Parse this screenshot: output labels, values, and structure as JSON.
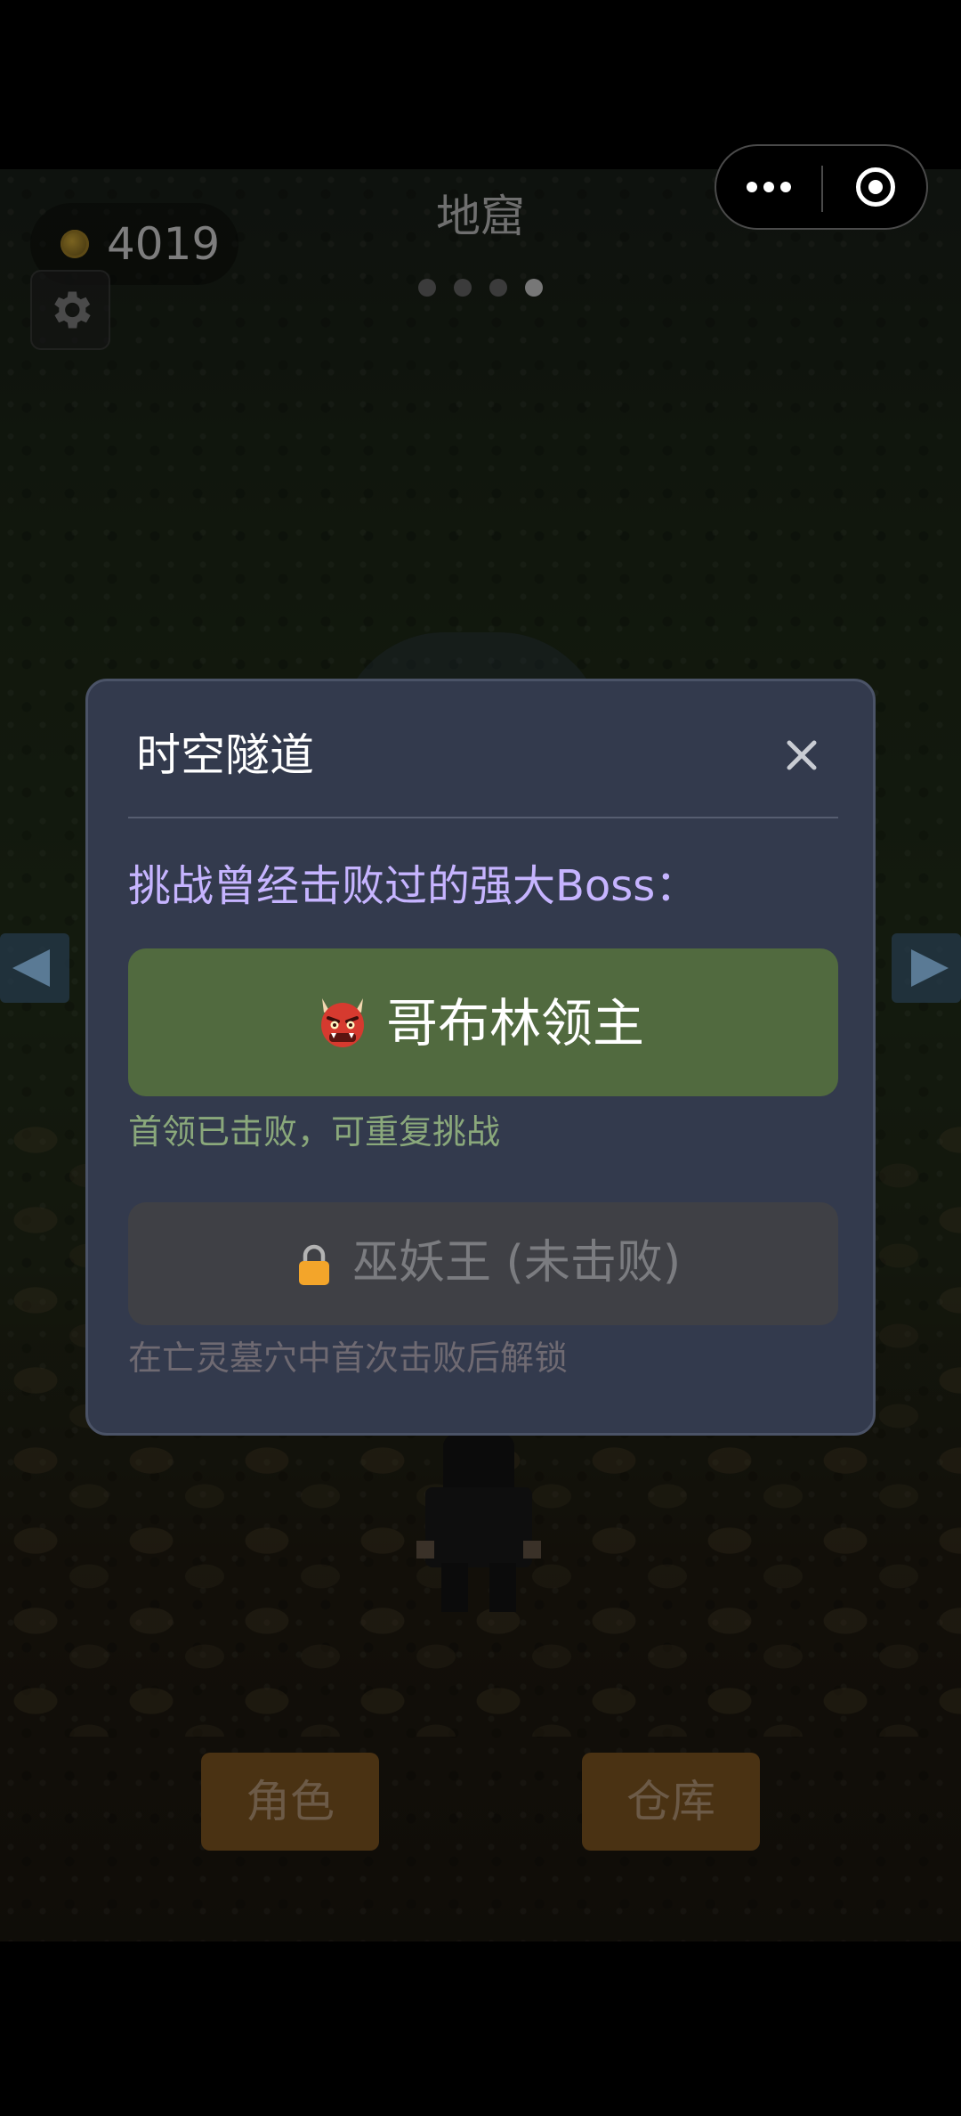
{
  "hud": {
    "gold": "4019",
    "level_title": "地窟",
    "pages_total": 4,
    "page_active": 4
  },
  "bottom_bar": {
    "character_label": "角色",
    "warehouse_label": "仓库"
  },
  "modal": {
    "title": "时空隧道",
    "subtitle": "挑战曾经击败过的强大Boss：",
    "bosses": [
      {
        "name": "哥布林领主",
        "icon": "ogre-icon",
        "note": "首领已击败，可重复挑战",
        "locked": false,
        "color": "#516a3f"
      },
      {
        "name": "巫妖王 (未击败)",
        "icon": "lock-icon",
        "note": "在亡灵墓穴中首次击败后解锁",
        "locked": true,
        "color": "#3f4045"
      }
    ]
  },
  "colors": {
    "modal_bg": "#333a4d",
    "accent_purple": "#c6b4ff",
    "boss_green": "#516a3f",
    "note_green": "#8aa87b",
    "button_brown": "#4a3213"
  },
  "icons": {
    "coin": "coin-icon",
    "settings": "gear-icon",
    "capsule_more": "more-dots-icon",
    "capsule_close": "target-icon",
    "modal_close": "close-icon",
    "arrow_left": "arrow-left-icon",
    "arrow_right": "arrow-right-icon"
  }
}
